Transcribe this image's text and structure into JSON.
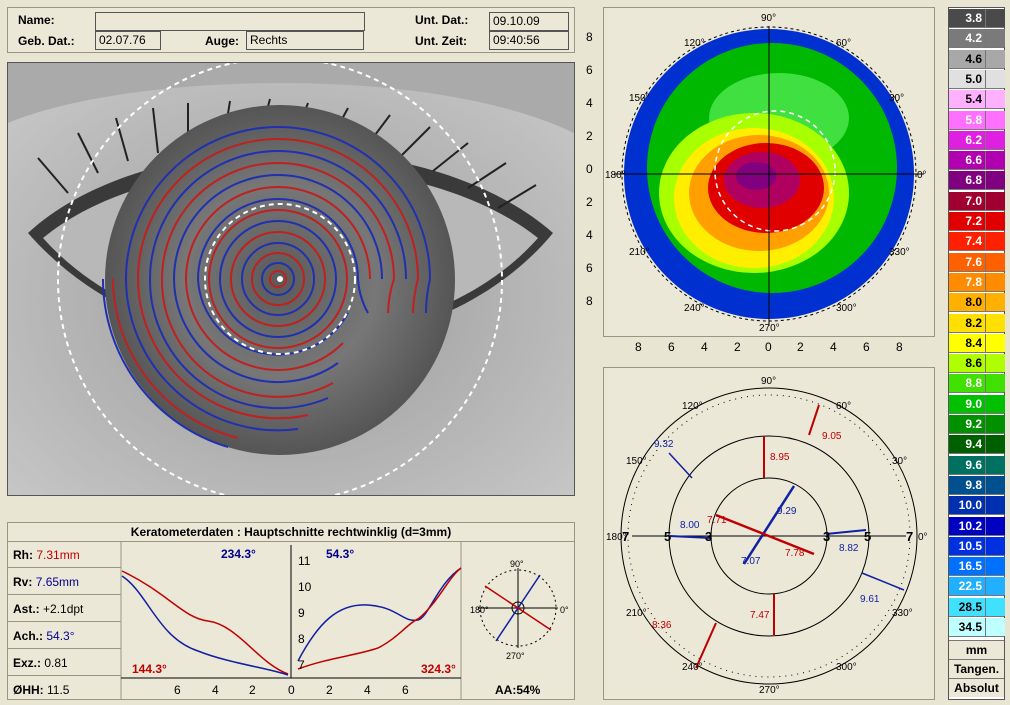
{
  "header": {
    "name_label": "Name:",
    "name_value": "",
    "gebdat_label": "Geb. Dat.:",
    "gebdat_value": "02.07.76",
    "auge_label": "Auge:",
    "auge_value": "Rechts",
    "untdat_label": "Unt. Dat.:",
    "untdat_value": "09.10.09",
    "untzeit_label": "Unt. Zeit:",
    "untzeit_value": "09:40:56"
  },
  "topo_map": {
    "angle_labels": [
      "90°",
      "60°",
      "30°",
      "0°",
      "330°",
      "300°",
      "270°",
      "240°",
      "210°",
      "180°",
      "150°",
      "120°"
    ],
    "y_ticks": [
      "8",
      "6",
      "4",
      "2",
      "0",
      "2",
      "4",
      "6",
      "8"
    ],
    "x_ticks": [
      "8",
      "6",
      "4",
      "2",
      "0",
      "2",
      "4",
      "6",
      "8"
    ]
  },
  "ring_map": {
    "angle_labels": [
      "90°",
      "60°",
      "30°",
      "0°",
      "330°",
      "300°",
      "270°",
      "240°",
      "210°",
      "180°",
      "150°",
      "120°"
    ],
    "ring_labels": [
      "7",
      "5",
      "3",
      "3",
      "5",
      "7"
    ],
    "values_red": [
      "9.05",
      "8.95",
      "7.71",
      "7.78",
      "7.47",
      "8.36"
    ],
    "values_blue": [
      "9.32",
      "9.29",
      "8.00",
      "7.07",
      "8.82",
      "9.61"
    ]
  },
  "kerato": {
    "title": "Keratometerdaten : Hauptschnitte rechtwinklig (d=3mm)",
    "rh_label": "Rh:",
    "rh_value": "7.31mm",
    "rv_label": "Rv:",
    "rv_value": "7.65mm",
    "ast_label": "Ast.:",
    "ast_value": "+2.1dpt",
    "ach_label": "Ach.:",
    "ach_value": "54.3°",
    "exz_label": "Exz.:",
    "exz_value": "0.81",
    "ohh_label": "ØHH:",
    "ohh_value": "11.5",
    "left_top_angle": "234.3°",
    "left_bottom_angle": "144.3°",
    "right_top_angle": "54.3°",
    "right_bottom_angle": "324.3°",
    "left_x_ticks": [
      "6",
      "4",
      "2",
      "0"
    ],
    "right_x_ticks": [
      "0",
      "2",
      "4",
      "6"
    ],
    "y_ticks": [
      "11",
      "10",
      "9",
      "8",
      "7"
    ],
    "mini_angles": [
      "90°",
      "180°",
      "0°",
      "270°"
    ],
    "aa_value": "AA:54%"
  },
  "scale": {
    "steps": [
      {
        "v": "3.8",
        "c": "#4a4a4a"
      },
      {
        "v": "4.2",
        "c": "#7a7a7a"
      },
      {
        "v": "4.6",
        "c": "#a8a8a8"
      },
      {
        "v": "5.0",
        "c": "#e0e0e0"
      },
      {
        "v": "5.4",
        "c": "#ffb0ff"
      },
      {
        "v": "5.8",
        "c": "#ff70ff"
      },
      {
        "v": "6.2",
        "c": "#e020e0"
      },
      {
        "v": "6.6",
        "c": "#b000b0"
      },
      {
        "v": "6.8",
        "c": "#800080"
      },
      {
        "v": "7.0",
        "c": "#a00030"
      },
      {
        "v": "7.2",
        "c": "#e00000"
      },
      {
        "v": "7.4",
        "c": "#ff2000"
      },
      {
        "v": "7.6",
        "c": "#ff6000"
      },
      {
        "v": "7.8",
        "c": "#ff8c00"
      },
      {
        "v": "8.0",
        "c": "#ffb000"
      },
      {
        "v": "8.2",
        "c": "#ffe000"
      },
      {
        "v": "8.4",
        "c": "#ffff00"
      },
      {
        "v": "8.6",
        "c": "#b0ff00"
      },
      {
        "v": "8.8",
        "c": "#40e000"
      },
      {
        "v": "9.0",
        "c": "#00c000"
      },
      {
        "v": "9.2",
        "c": "#009000"
      },
      {
        "v": "9.4",
        "c": "#006000"
      },
      {
        "v": "9.6",
        "c": "#007060"
      },
      {
        "v": "9.8",
        "c": "#005090"
      },
      {
        "v": "10.0",
        "c": "#0030b0"
      },
      {
        "v": "10.2",
        "c": "#0000c0"
      },
      {
        "v": "10.5",
        "c": "#0030e0"
      },
      {
        "v": "16.5",
        "c": "#0070ff"
      },
      {
        "v": "22.5",
        "c": "#20b0ff"
      },
      {
        "v": "28.5",
        "c": "#40e0ff"
      },
      {
        "v": "34.5",
        "c": "#c0ffff"
      }
    ],
    "unit_label": "mm",
    "tangen_label": "Tangen.",
    "absolut_label": "Absolut"
  }
}
